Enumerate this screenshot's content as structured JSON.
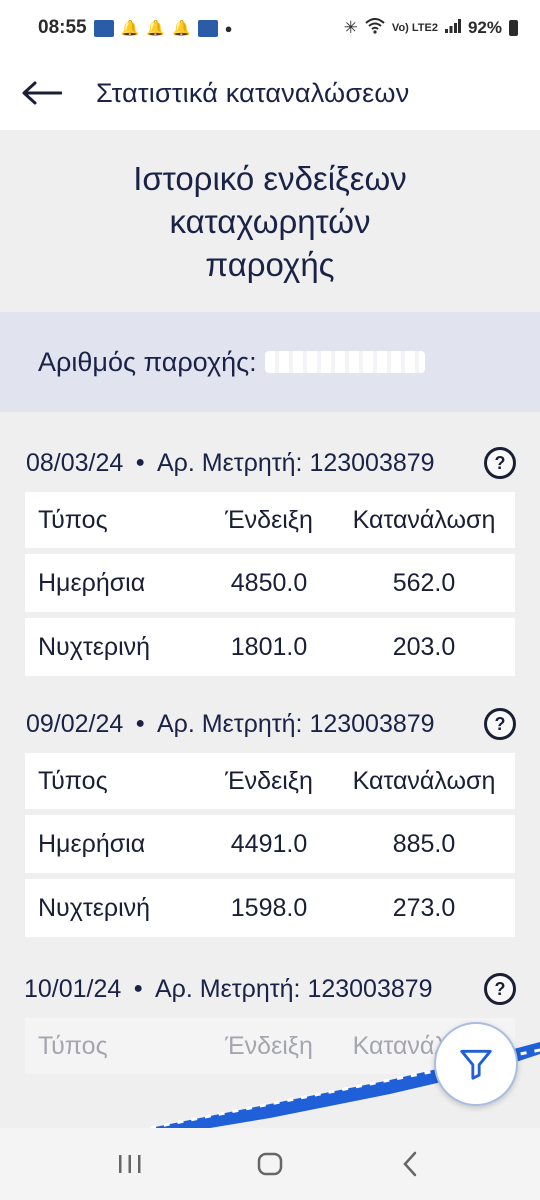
{
  "status_bar": {
    "time": "08:55",
    "carrier": "Vo) LTE2",
    "battery": "92%",
    "icons": [
      "news-icon",
      "bell-icon",
      "bell-icon",
      "bell-icon",
      "news-icon",
      "dot-icon",
      "bluetooth-icon",
      "wifi-icon",
      "signal-icon",
      "battery-icon"
    ]
  },
  "app_bar": {
    "back_icon": "back-arrow-icon",
    "title": "Στατιστικά καταναλώσεων"
  },
  "page_heading": {
    "line1": "Ιστορικό ενδείξεων",
    "line2": "καταχωρητών",
    "line3": "παροχής"
  },
  "supply": {
    "label": "Αριθμός παροχής:"
  },
  "table_headers": {
    "type": "Τύπος",
    "index": "Ένδειξη",
    "consumption": "Κατανάλωση"
  },
  "readings": [
    {
      "date": "08/03/24",
      "meter_label": "Αρ. Μετρητή:",
      "meter_number": "123003879",
      "rows": [
        {
          "type": "Ημερήσια",
          "index": "4850.0",
          "consumption": "562.0"
        },
        {
          "type": "Νυχτερινή",
          "index": "1801.0",
          "consumption": "203.0"
        }
      ]
    },
    {
      "date": "09/02/24",
      "meter_label": "Αρ. Μετρητή:",
      "meter_number": "123003879",
      "rows": [
        {
          "type": "Ημερήσια",
          "index": "4491.0",
          "consumption": "885.0"
        },
        {
          "type": "Νυχτερινή",
          "index": "1598.0",
          "consumption": "273.0"
        }
      ]
    },
    {
      "date": "10/01/24",
      "meter_label": "Αρ. Μετρητή:",
      "meter_number": "123003879",
      "rows": []
    }
  ],
  "info_icon_glyph": "?",
  "fab": {
    "icon": "filter-icon"
  },
  "colors": {
    "primary_text": "#1a2347",
    "band_bg": "#e1e4ef",
    "page_bg": "#efefef",
    "accent_blue": "#1f5fd8"
  }
}
